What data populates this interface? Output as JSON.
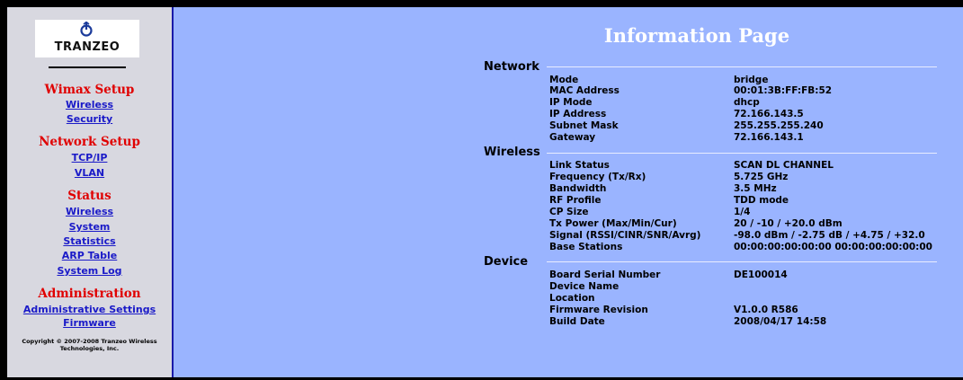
{
  "logo": {
    "text": "TRANZEO",
    "icon": "tranzeo-swirl-icon"
  },
  "sidebar": {
    "sections": [
      {
        "title": "Wimax Setup",
        "links": [
          "Wireless",
          "Security"
        ]
      },
      {
        "title": "Network Setup",
        "links": [
          "TCP/IP",
          "VLAN"
        ]
      },
      {
        "title": "Status",
        "links": [
          "Wireless",
          "System",
          "Statistics",
          "ARP Table",
          "System Log"
        ]
      },
      {
        "title": "Administration",
        "links": [
          "Administrative Settings",
          "Firmware"
        ]
      }
    ],
    "copyright_line1": "Copyright © 2007-2008 Tranzeo Wireless",
    "copyright_line2": "Technologies, Inc."
  },
  "main": {
    "title": "Information Page",
    "groups": [
      {
        "name": "Network",
        "rows": [
          {
            "label": "Mode",
            "value": "bridge"
          },
          {
            "label": "MAC Address",
            "value": "00:01:3B:FF:FB:52"
          },
          {
            "label": "IP Mode",
            "value": "dhcp"
          },
          {
            "label": "IP Address",
            "value": "72.166.143.5"
          },
          {
            "label": "Subnet Mask",
            "value": "255.255.255.240"
          },
          {
            "label": "Gateway",
            "value": "72.166.143.1"
          }
        ]
      },
      {
        "name": "Wireless",
        "rows": [
          {
            "label": "Link Status",
            "value": "SCAN DL CHANNEL"
          },
          {
            "label": "Frequency (Tx/Rx)",
            "value": "5.725 GHz"
          },
          {
            "label": "Bandwidth",
            "value": "3.5 MHz"
          },
          {
            "label": "RF Profile",
            "value": "TDD mode"
          },
          {
            "label": "CP Size",
            "value": "1/4"
          },
          {
            "label": "Tx Power (Max/Min/Cur)",
            "value": "20 / -10 / +20.0 dBm"
          },
          {
            "label": "Signal (RSSI/CINR/SNR/Avrg)",
            "value": "-98.0 dBm / -2.75 dB / +4.75 / +32.0"
          },
          {
            "label": "Base Stations",
            "value": "00:00:00:00:00:00 00:00:00:00:00:00"
          }
        ]
      },
      {
        "name": "Device",
        "rows": [
          {
            "label": "Board Serial Number",
            "value": "DE100014"
          },
          {
            "label": "Device Name",
            "value": ""
          },
          {
            "label": "Location",
            "value": ""
          },
          {
            "label": "Firmware Revision",
            "value": "V1.0.0 R586"
          },
          {
            "label": "Build Date",
            "value": "2008/04/17 14:58"
          }
        ]
      }
    ]
  },
  "colors": {
    "sidebar_bg": "#d8d8e0",
    "main_bg": "#9ab4ff",
    "section_title": "#e00000",
    "link": "#1a1ac8"
  }
}
